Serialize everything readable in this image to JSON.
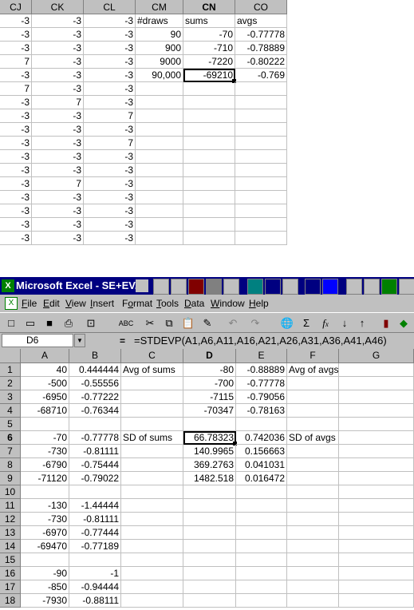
{
  "top_sheet": {
    "columns": [
      {
        "label": "CJ",
        "selected": false
      },
      {
        "label": "CK",
        "selected": false
      },
      {
        "label": "CL",
        "selected": false
      },
      {
        "label": "CM",
        "selected": false
      },
      {
        "label": "CN",
        "selected": true
      },
      {
        "label": "CO",
        "selected": false
      }
    ],
    "rows": [
      [
        "-3",
        "-3",
        "-3",
        "#draws",
        "sums",
        "avgs"
      ],
      [
        "-3",
        "-3",
        "-3",
        "90",
        "-70",
        "-0.77778"
      ],
      [
        "-3",
        "-3",
        "-3",
        "900",
        "-710",
        "-0.78889"
      ],
      [
        "7",
        "-3",
        "-3",
        "9000",
        "-7220",
        "-0.80222"
      ],
      [
        "-3",
        "-3",
        "-3",
        "90,000",
        "-69210",
        "-0.769"
      ],
      [
        "7",
        "-3",
        "-3",
        "",
        "",
        ""
      ],
      [
        "-3",
        "7",
        "-3",
        "",
        "",
        ""
      ],
      [
        "-3",
        "-3",
        "7",
        "",
        "",
        ""
      ],
      [
        "-3",
        "-3",
        "-3",
        "",
        "",
        ""
      ],
      [
        "-3",
        "-3",
        "7",
        "",
        "",
        ""
      ],
      [
        "-3",
        "-3",
        "-3",
        "",
        "",
        ""
      ],
      [
        "-3",
        "-3",
        "-3",
        "",
        "",
        ""
      ],
      [
        "-3",
        "7",
        "-3",
        "",
        "",
        ""
      ],
      [
        "-3",
        "-3",
        "-3",
        "",
        "",
        ""
      ],
      [
        "-3",
        "-3",
        "-3",
        "",
        "",
        ""
      ],
      [
        "-3",
        "-3",
        "-3",
        "",
        "",
        ""
      ],
      [
        "-3",
        "-3",
        "-3",
        "",
        "",
        ""
      ]
    ]
  },
  "excel": {
    "title": "Microsoft Excel - SE+EV.xl",
    "menu": [
      {
        "label": "File",
        "key": "F"
      },
      {
        "label": "Edit",
        "key": "E"
      },
      {
        "label": "View",
        "key": "V"
      },
      {
        "label": "Insert",
        "key": "I"
      },
      {
        "label": "Format",
        "key": "o"
      },
      {
        "label": "Tools",
        "key": "T"
      },
      {
        "label": "Data",
        "key": "D"
      },
      {
        "label": "Window",
        "key": "W"
      },
      {
        "label": "Help",
        "key": "H"
      }
    ],
    "name_box": "D6",
    "equals": "=",
    "formula": "=STDEVP(A1,A6,A11,A16,A21,A26,A31,A36,A41,A46)",
    "columns": [
      "A",
      "B",
      "C",
      "D",
      "E",
      "F",
      "G"
    ],
    "selected_column": "D",
    "rows": [
      {
        "n": "1",
        "cells": [
          "40",
          "0.444444",
          "Avg of sums",
          "-80",
          "-0.88889",
          "Avg of avgs",
          ""
        ]
      },
      {
        "n": "2",
        "cells": [
          "-500",
          "-0.55556",
          "",
          "-700",
          "-0.77778",
          "",
          ""
        ]
      },
      {
        "n": "3",
        "cells": [
          "-6950",
          "-0.77222",
          "",
          "-7115",
          "-0.79056",
          "",
          ""
        ]
      },
      {
        "n": "4",
        "cells": [
          "-68710",
          "-0.76344",
          "",
          "-70347",
          "-0.78163",
          "",
          ""
        ]
      },
      {
        "n": "5",
        "cells": [
          "",
          "",
          "",
          "",
          "",
          "",
          ""
        ]
      },
      {
        "n": "6",
        "cells": [
          "-70",
          "-0.77778",
          "SD of sums",
          "66.78323",
          "0.742036",
          "SD of avgs",
          ""
        ]
      },
      {
        "n": "7",
        "cells": [
          "-730",
          "-0.81111",
          "",
          "140.9965",
          "0.156663",
          "",
          ""
        ]
      },
      {
        "n": "8",
        "cells": [
          "-6790",
          "-0.75444",
          "",
          "369.2763",
          "0.041031",
          "",
          ""
        ]
      },
      {
        "n": "9",
        "cells": [
          "-71120",
          "-0.79022",
          "",
          "1482.518",
          "0.016472",
          "",
          ""
        ]
      },
      {
        "n": "10",
        "cells": [
          "",
          "",
          "",
          "",
          "",
          "",
          ""
        ]
      },
      {
        "n": "11",
        "cells": [
          "-130",
          "-1.44444",
          "",
          "",
          "",
          "",
          ""
        ]
      },
      {
        "n": "12",
        "cells": [
          "-730",
          "-0.81111",
          "",
          "",
          "",
          "",
          ""
        ]
      },
      {
        "n": "13",
        "cells": [
          "-6970",
          "-0.77444",
          "",
          "",
          "",
          "",
          ""
        ]
      },
      {
        "n": "14",
        "cells": [
          "-69470",
          "-0.77189",
          "",
          "",
          "",
          "",
          ""
        ]
      },
      {
        "n": "15",
        "cells": [
          "",
          "",
          "",
          "",
          "",
          "",
          ""
        ]
      },
      {
        "n": "16",
        "cells": [
          "-90",
          "-1",
          "",
          "",
          "",
          "",
          ""
        ]
      },
      {
        "n": "17",
        "cells": [
          "-850",
          "-0.94444",
          "",
          "",
          "",
          "",
          ""
        ]
      },
      {
        "n": "18",
        "cells": [
          "-7930",
          "-0.88111",
          "",
          "",
          "",
          "",
          ""
        ]
      }
    ]
  },
  "colors": {
    "titlebar": "#000080",
    "chrome": "#c0c0c0",
    "gridline": "#c0c0c0"
  }
}
